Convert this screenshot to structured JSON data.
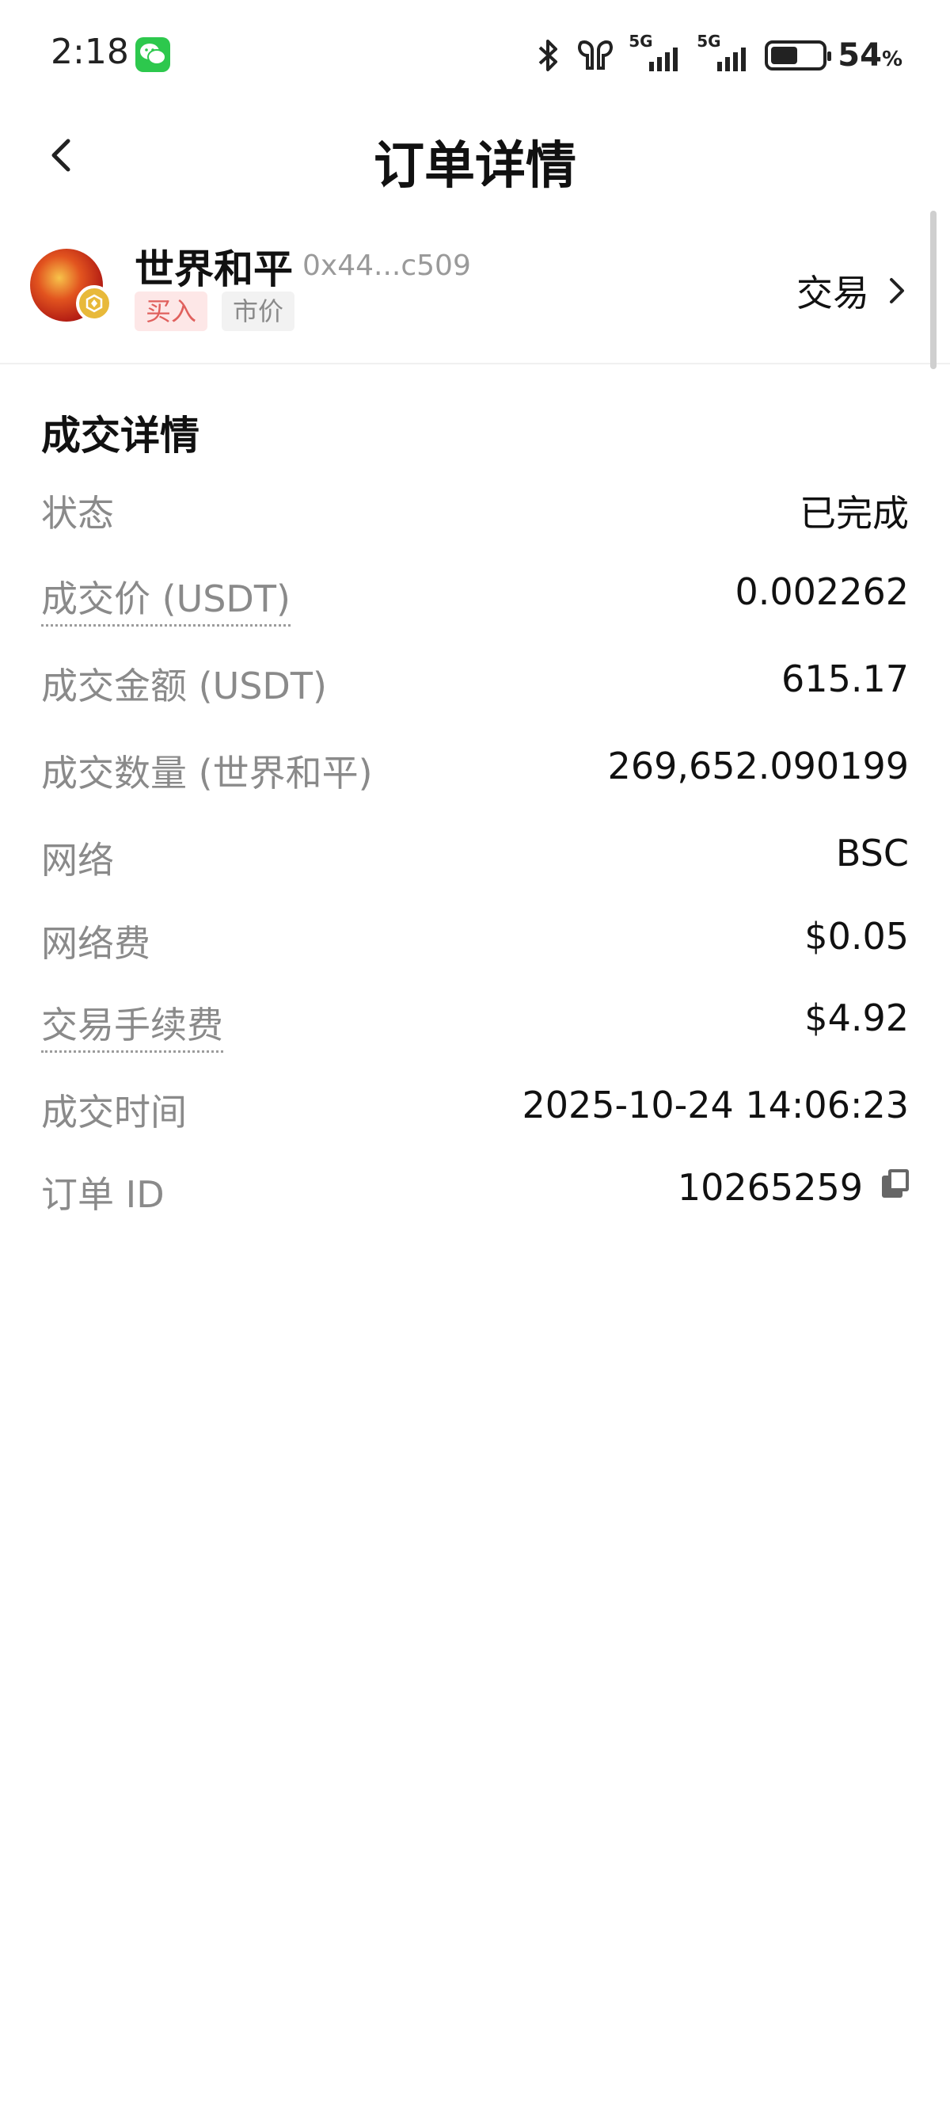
{
  "status_bar": {
    "time": "2:18",
    "network1": "5G",
    "network2": "5G",
    "battery_pct": "54",
    "battery_unit": "%",
    "battery_level": 0.54
  },
  "header": {
    "title": "订单详情"
  },
  "token": {
    "name": "世界和平",
    "address": "0x44...c509",
    "side_tag": "买入",
    "type_tag": "市价",
    "trade_link": "交易"
  },
  "details": {
    "section_title": "成交详情",
    "rows": [
      {
        "label": "状态",
        "value": "已完成"
      },
      {
        "label": "成交价 (USDT)",
        "value": "0.002262"
      },
      {
        "label": "成交金额 (USDT)",
        "value": "615.17"
      },
      {
        "label": "成交数量 (世界和平)",
        "value": "269,652.090199"
      },
      {
        "label": "网络",
        "value": "BSC"
      },
      {
        "label": "网络费",
        "value": "$0.05"
      },
      {
        "label": "交易手续费",
        "value": "$4.92"
      },
      {
        "label": "成交时间",
        "value": "2025-10-24 14:06:23"
      },
      {
        "label": "订单 ID",
        "value": "10265259"
      }
    ]
  },
  "colors": {
    "buy_tag_bg": "#fde7e7",
    "buy_tag_text": "#e0605d",
    "label_gray": "#8a8a8a",
    "wechat_green": "#2dc84d"
  }
}
